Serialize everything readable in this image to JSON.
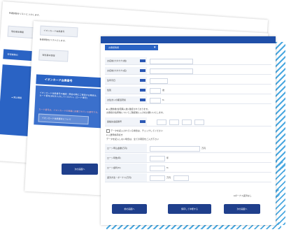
{
  "back": {
    "notice": "各選択肢をリストに 入力します。",
    "tab": "現在基本情報",
    "section_title": "取得業務ID",
    "side_label": "● 見込情報",
    "next_button": "次の画面へ"
  },
  "mid": {
    "tab": "イオンカード会員番号",
    "notice": "各選択肢をリストにします。",
    "label": "現在基本情報",
    "banner": "イオンカード会員番号",
    "desc": "イオンカード会員番号の確認・照合の際にご使用する場合は、カード番号(3桁)を入力してください。(カード番号)",
    "warning": "カード番号は、イオンカードの表面に記載されている番号です。",
    "link": "イオンカード会員番号について",
    "next_button": "次の画面へ"
  },
  "front": {
    "section_header": "お客様情報",
    "rows": [
      {
        "label": "お名前(カタカナ)(姓)"
      },
      {
        "label": "お名前(カタカナ)(名)"
      },
      {
        "label": "生年月日"
      },
      {
        "label": "性別",
        "unit": "歳"
      },
      {
        "label": "お住まいの都道府県",
        "unit": "%"
      }
    ],
    "note1": "■ 入居前後(住宅購入前) 確認されております。",
    "note2": "お客様の住所等についてご確認後に入力をお願いいたします。",
    "contact_label": "連絡先電話番号",
    "checkbox1": "データを記入されている場合は、チェックしてください",
    "checkbox2": "● 入居申請手続き",
    "note3": "データを記入しない場合は、全ての項目をご入力下さい",
    "bottom_rows": [
      {
        "label": "ローン申込金額(万円)",
        "unit": "万円"
      },
      {
        "label": "ローン年数(年)",
        "unit": "年"
      },
      {
        "label": "ローン金利(%)",
        "unit": "%"
      },
      {
        "label": "返済方法・ボーナス(万円)",
        "unit": "万円"
      }
    ],
    "footnote": "●ボーナス返済なし",
    "btn_back": "前の画面へ",
    "btn_save": "保存して中断する",
    "btn_next": "次の画面へ"
  }
}
